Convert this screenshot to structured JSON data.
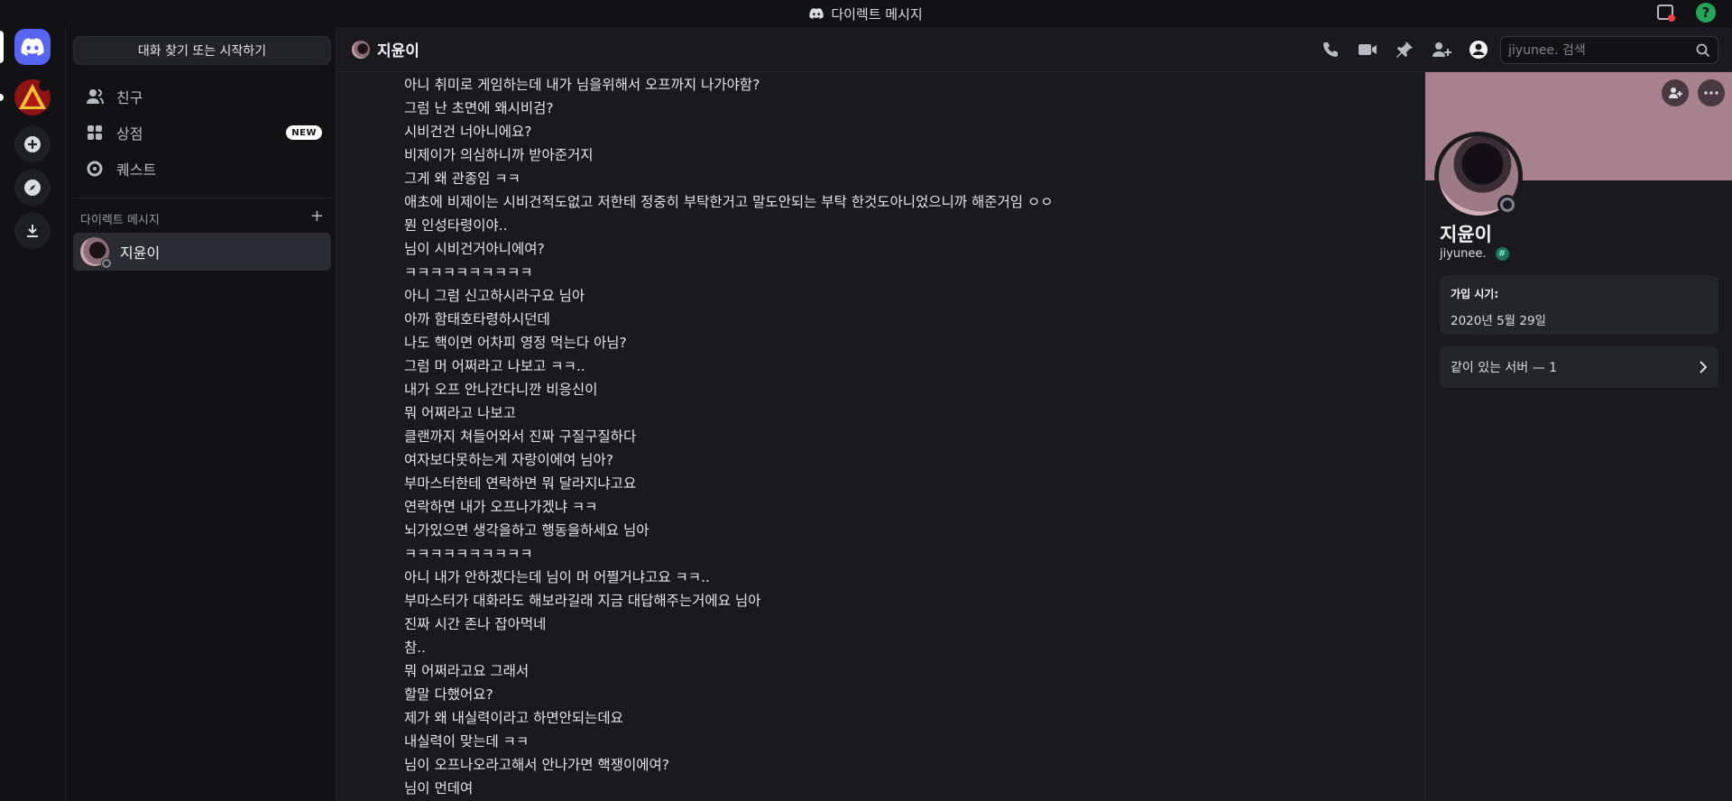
{
  "titlebar": {
    "title": "다이렉트 메시지"
  },
  "sidebar": {
    "search_button": "대화 찾기 또는 시작하기",
    "nav": [
      {
        "label": "친구"
      },
      {
        "label": "상점",
        "badge": "NEW"
      },
      {
        "label": "퀘스트"
      }
    ],
    "dm_header": "다이렉트 메시지",
    "dm_add": "+",
    "dms": [
      {
        "name": "지윤이"
      }
    ]
  },
  "chat": {
    "channel_name": "지윤이",
    "search_placeholder": "jiyunee. 검색",
    "messages": [
      "아니 취미로 게임하는데 내가 님을위해서 오프까지 나가야함?",
      "그럼 난 초면에 왜시비검?",
      "시비건건 너아니에요?",
      "비제이가 의심하니까 받아준거지",
      "그게 왜 관종임 ㅋㅋ",
      "애초에 비제이는 시비건적도없고 저한테 정중히 부탁한거고 말도안되는 부탁 한것도아니었으니까 해준거임 ㅇㅇ",
      "뭔 인성타령이야..",
      "님이 시비건거아니에여?",
      "ㅋㅋㅋㅋㅋㅋㅋㅋㅋㅋ",
      "아니 그럼 신고하시라구요 님아",
      "아까 함태호타령하시던데",
      "나도 핵이면 어차피 영정 먹는다 아님?",
      "그럼 머 어쩌라고 나보고 ㅋㅋ..",
      "내가 오프 안나간다니깐 비응신이",
      "뭐 어쩌라고 나보고",
      "클랜까지 쳐들어와서 진짜 구질구질하다",
      "여자보다못하는게 자랑이에여 님아?",
      "부마스터한테 연락하면 뭐 달라지냐고요",
      "연락하면 내가 오프나가겠냐 ㅋㅋ",
      "뇌가있으면 생각을하고 행동을하세요 님아",
      "ㅋㅋㅋㅋㅋㅋㅋㅋㅋㅋ",
      "아니 내가 안하겠다는데 님이 머 어쩔거냐고요 ㅋㅋ..",
      "부마스터가 대화라도 해보라길래 지금 대답해주는거에요 님아",
      "진짜 시간 존나 잡아먹네",
      "참..",
      "뭐 어쩌라고요 그래서",
      "할말 다했어요?",
      "제가 왜 내실력이라고 하면안되는데요",
      "내실력이 맞는데 ㅋㅋ",
      "님이 오프나오라고해서 안나가면 핵쟁이에여?",
      "님이 먼데여"
    ]
  },
  "profile": {
    "display_name": "지윤이",
    "username": "jiyunee.",
    "badge": "#",
    "joined_label": "가입 시기:",
    "joined_value": "2020년 5월 29일",
    "mutual_servers": "같이 있는 서버 — 1"
  }
}
